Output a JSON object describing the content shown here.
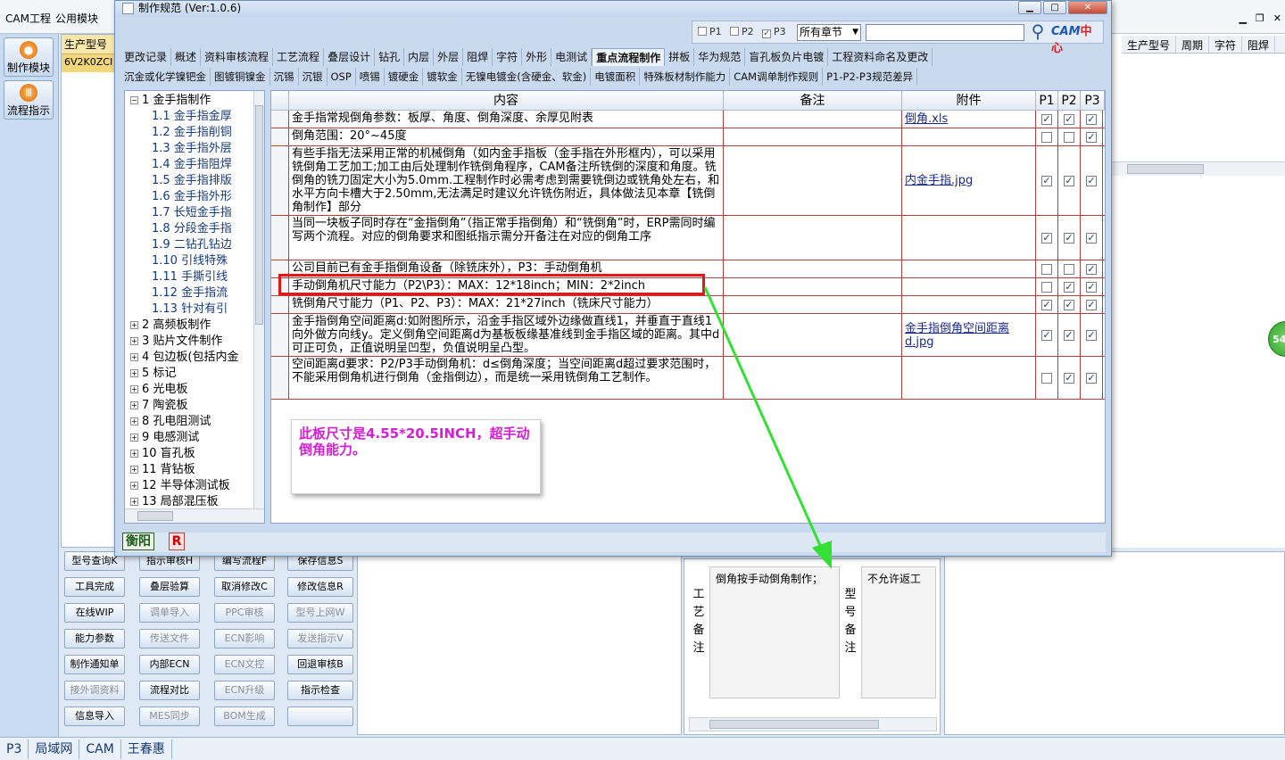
{
  "background_app": {
    "menu": [
      "CAM工程",
      "公用模块"
    ],
    "side_buttons": [
      "制作模块",
      "流程指示"
    ],
    "left_grid": {
      "header": "生产型号",
      "cell": "6V2K0ZCI"
    },
    "right_grid_headers": [
      "生产型号",
      "周期",
      "字符",
      "阻焊"
    ],
    "green_badge": "54",
    "actions": [
      {
        "label": "型号查询K",
        "enabled": true
      },
      {
        "label": "指示审核H",
        "enabled": true
      },
      {
        "label": "编写流程F",
        "enabled": true
      },
      {
        "label": "保存信息S",
        "enabled": true
      },
      {
        "label": "工具完成",
        "enabled": true
      },
      {
        "label": "叠层验算",
        "enabled": true
      },
      {
        "label": "取消修改C",
        "enabled": true
      },
      {
        "label": "修改信息R",
        "enabled": true
      },
      {
        "label": "在线WIP",
        "enabled": true
      },
      {
        "label": "调单导入",
        "enabled": false
      },
      {
        "label": "PPC审核",
        "enabled": false
      },
      {
        "label": "型号上网W",
        "enabled": false
      },
      {
        "label": "能力参数",
        "enabled": true
      },
      {
        "label": "传送文件",
        "enabled": false
      },
      {
        "label": "ECN影响",
        "enabled": false
      },
      {
        "label": "发送指示V",
        "enabled": false
      },
      {
        "label": "制作通知单",
        "enabled": true
      },
      {
        "label": "内部ECN",
        "enabled": true
      },
      {
        "label": "ECN文控",
        "enabled": false
      },
      {
        "label": "回退审核B",
        "enabled": true
      },
      {
        "label": "接外调资料",
        "enabled": false
      },
      {
        "label": "流程对比",
        "enabled": true
      },
      {
        "label": "ECN升级",
        "enabled": false
      },
      {
        "label": "指示检查",
        "enabled": true
      },
      {
        "label": "信息导入",
        "enabled": true
      },
      {
        "label": "MES同步",
        "enabled": false
      },
      {
        "label": "BOM生成",
        "enabled": false
      },
      {
        "label": "",
        "enabled": false
      }
    ],
    "process_note_label": "工艺备注",
    "process_note_text": "倒角按手动倒角制作；",
    "model_note_label": "型号备注",
    "model_note_text": "不允许返工",
    "status_bar": [
      "P3",
      "局域网",
      "CAM",
      "王春惠"
    ]
  },
  "dialog": {
    "title": "制作规范 (Ver:1.0.6)",
    "search": {
      "checkboxes": [
        {
          "label": "P1",
          "checked": false
        },
        {
          "label": "P2",
          "checked": false
        },
        {
          "label": "P3",
          "checked": true
        }
      ],
      "chapter": "所有章节",
      "query": "",
      "logo_text": "CAM",
      "logo_text_cn": "中心"
    },
    "tabs_row1": [
      "更改记录",
      "概述",
      "资料审核流程",
      "工艺流程",
      "叠层设计",
      "钻孔",
      "内层",
      "外层",
      "阻焊",
      "字符",
      "外形",
      "电测试",
      "重点流程制作",
      "拼板",
      "华为规范",
      "盲孔板负片电镀",
      "工程资料命名及更改"
    ],
    "active_tab": "重点流程制作",
    "tabs_row2": [
      "沉金或化学镍钯金",
      "图镀铜镍金",
      "沉锡",
      "沉银",
      "OSP",
      "喷锡",
      "镀硬金",
      "镀软金",
      "无镍电镀金(含硬金、软金)",
      "电镀面积",
      "特殊板材制作能力",
      "CAM调单制作规则",
      "P1-P2-P3规范差异"
    ],
    "tree": [
      {
        "label": "1 金手指制作",
        "expanded": true,
        "level": 1
      },
      {
        "label": "1.1 金手指金厚",
        "level": 2
      },
      {
        "label": "1.2 金手指削铜",
        "level": 2
      },
      {
        "label": "1.3 金手指外层",
        "level": 2
      },
      {
        "label": "1.4 金手指阻焊",
        "level": 2
      },
      {
        "label": "1.5 金手指排版",
        "level": 2
      },
      {
        "label": "1.6 金手指外形",
        "level": 2
      },
      {
        "label": "1.7 长短金手指",
        "level": 2
      },
      {
        "label": "1.8 分段金手指",
        "level": 2
      },
      {
        "label": "1.9 二钻孔钻边",
        "level": 2
      },
      {
        "label": "1.10 引线特殊",
        "level": 2
      },
      {
        "label": "1.11 手撕引线",
        "level": 2
      },
      {
        "label": "1.12 金手指流",
        "level": 2
      },
      {
        "label": "1.13 针对有引",
        "level": 2
      },
      {
        "label": "2 高频板制作",
        "level": 1
      },
      {
        "label": "3 贴片文件制作",
        "level": 1
      },
      {
        "label": "4 包边板(包括内金",
        "level": 1
      },
      {
        "label": "5 标记",
        "level": 1
      },
      {
        "label": "6 光电板",
        "level": 1
      },
      {
        "label": "7 陶瓷板",
        "level": 1
      },
      {
        "label": "8 孔电阻测试",
        "level": 1
      },
      {
        "label": "9 电感测试",
        "level": 1
      },
      {
        "label": "10 盲孔板",
        "level": 1
      },
      {
        "label": "11 背钻板",
        "level": 1
      },
      {
        "label": "12 半导体测试板",
        "level": 1
      },
      {
        "label": "13 局部混压板",
        "level": 1
      }
    ],
    "grid": {
      "headers": [
        "内容",
        "备注",
        "附件",
        "P1",
        "P2",
        "P3"
      ],
      "rows": [
        {
          "content": "金手指常规倒角参数：板厚、角度、倒角深度、余厚见附表",
          "note": "",
          "attachment": "倒角.xls",
          "p": [
            true,
            true,
            true
          ]
        },
        {
          "content": "倒角范围：20°~45度",
          "note": "",
          "attachment": "",
          "p": [
            false,
            false,
            true
          ]
        },
        {
          "content": "有些手指无法采用正常的机械倒角（如内金手指板（金手指在外形框内），可以采用铣倒角工艺加工;加工由后处理制作铣倒角程序，CAM备注所铣倒的深度和角度。铣倒角的铣刀固定大小为5.0mm.工程制作时必需考虑到需要铣倒边或铣角处左右，和水平方向卡槽大于2.50mm,无法满足时建议允许铣伤附近，具体做法见本章【铣倒角制作】部分",
          "note": "",
          "attachment": "内金手指.jpg",
          "p": [
            true,
            true,
            true
          ]
        },
        {
          "content": "当同一块板子同时存在“金指倒角”（指正常手指倒角）和“铣倒角”时，ERP需同时编写两个流程。对应的倒角要求和图纸指示需分开备注在对应的倒角工序",
          "note": "",
          "attachment": "",
          "p": [
            true,
            true,
            true
          ]
        },
        {
          "content": "公司目前已有金手指倒角设备（除铣床外），P3：手动倒角机",
          "note": "",
          "attachment": "",
          "p": [
            false,
            false,
            true
          ]
        },
        {
          "content": "手动倒角机尺寸能力（P2\\P3）：MAX：12*18inch；MIN：2*2inch",
          "note": "",
          "attachment": "",
          "p": [
            false,
            true,
            true
          ]
        },
        {
          "content": "铣倒角尺寸能力（P1、P2、P3）：MAX：21*27inch（铣床尺寸能力）",
          "note": "",
          "attachment": "",
          "p": [
            true,
            true,
            true
          ]
        },
        {
          "content": "金手指倒角空间距离d:如附图所示，沿金手指区域外边缘做直线1，并垂直于直线1向外做方向线y。定义倒角空间距离d为基板板缘基准线到金手指区域的距离。其中d可正可负，正值说明呈凹型，负值说明呈凸型。",
          "note": "",
          "attachment": "金手指倒角空间距离d.jpg",
          "p": [
            true,
            true,
            true
          ]
        },
        {
          "content": "空间距离d要求：P2/P3手动倒角机：d≤倒角深度；当空间距离d超过要求范围时，不能采用倒角机进行倒角（金指倒边），而是统一采用铣倒角工艺制作。",
          "note": "",
          "attachment": "",
          "p": [
            false,
            true,
            true
          ]
        }
      ]
    },
    "callout": "此板尺寸是4.55*20.5INCH，超手动倒角能力。",
    "footer_company": "衡阳",
    "footer_badge": "R"
  }
}
